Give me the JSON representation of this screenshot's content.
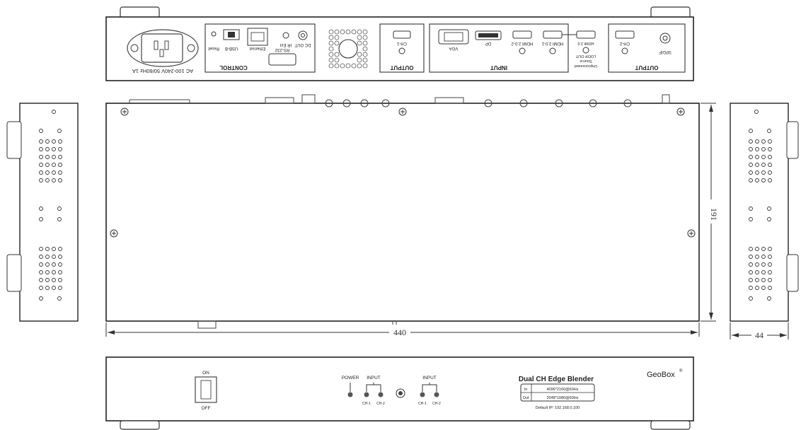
{
  "rear_panel": {
    "power_rating": "AC 100-240V 50/60Hz 1A",
    "control_group": "CONTROL",
    "reset_label": "Reset",
    "usb_label": "USB-B",
    "ethernet_label": "Ethernet",
    "ir_label": "IR Ext",
    "dc_out_label": "DC OUT",
    "rs232_label": "RS-232",
    "output_left_group": "OUTPUT",
    "ch1_label": "CH-1",
    "input_group": "INPUT",
    "vga_label": "VGA",
    "dp_label": "DP",
    "hdmi20_2_label": "HDMI 2.0-2",
    "hdmi20_1_label": "HDMI 2.0-1",
    "loop_label": "HDMI 2.0",
    "loop_label_2": "LOOP OUT",
    "loop_label_3": "Source",
    "loop_label_4": "Unprocessed",
    "output_right_group": "OUTPUT",
    "ch2_label": "CH-2",
    "spdif_label": "SPDIF"
  },
  "dimensions": {
    "width": "440",
    "depth": "191",
    "height": "44"
  },
  "front_panel": {
    "switch_on": "ON",
    "switch_off": "OFF",
    "power_label": "POWER",
    "input_label_1": "INPUT",
    "input_label_2": "INPUT",
    "ch1": "CH-1",
    "ch2": "CH-2",
    "product_name": "Dual CH Edge Blender",
    "in_label": "In",
    "in_value": "4096*2160@60Hz",
    "out_label": "Out",
    "out_value": "2048*1080@60Hz",
    "default_ip": "Default IP: 192.168.0.100",
    "brand": "GeoBox",
    "brand_mark": "®"
  }
}
